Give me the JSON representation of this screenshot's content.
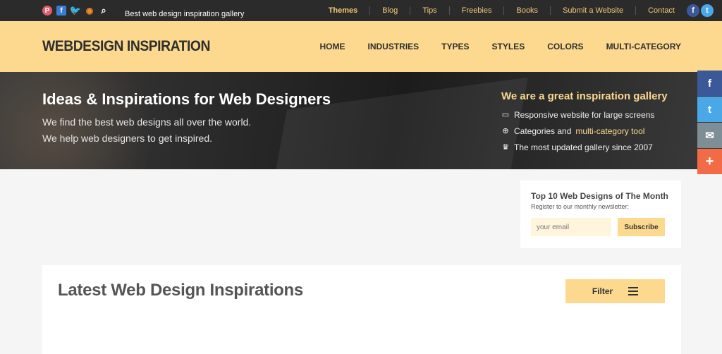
{
  "topbar": {
    "icons": [
      "pinterest-icon",
      "facebook-icon",
      "twitter-icon",
      "rss-icon",
      "search-icon"
    ],
    "tagline": "Best web design inspiration gallery",
    "nav": [
      "Themes",
      "Blog",
      "Tips",
      "Freebies",
      "Books",
      "Submit a Website",
      "Contact"
    ],
    "social": [
      "facebook-icon",
      "twitter-icon"
    ]
  },
  "header": {
    "logo": "WEBDESIGN INSPIRATION",
    "nav": [
      "HOME",
      "INDUSTRIES",
      "TYPES",
      "STYLES",
      "COLORS",
      "MULTI-CATEGORY"
    ]
  },
  "hero": {
    "title": "Ideas & Inspirations for Web Designers",
    "line1": "We find the best web designs all over the world.",
    "line2": "We help web designers to get inspired.",
    "right_title": "We are a great inspiration gallery",
    "feature1": "Responsive website for large screens",
    "feature2_text": "Categories and",
    "feature2_link": "multi-category tool",
    "feature3": "The most updated gallery since 2007"
  },
  "share": [
    "facebook-icon",
    "twitter-icon",
    "email-icon",
    "plus-icon"
  ],
  "newsletter": {
    "title": "Top 10 Web Designs of The Month",
    "subtitle": "Register to our monthly newsletter:",
    "placeholder": "your email",
    "button": "Subscribe"
  },
  "latest": {
    "title": "Latest Web Design Inspirations",
    "filter": "Filter"
  },
  "colors": {
    "accent": "#fcd98f",
    "topbar": "#2b2b2b",
    "nav_link": "#f6c87a"
  }
}
